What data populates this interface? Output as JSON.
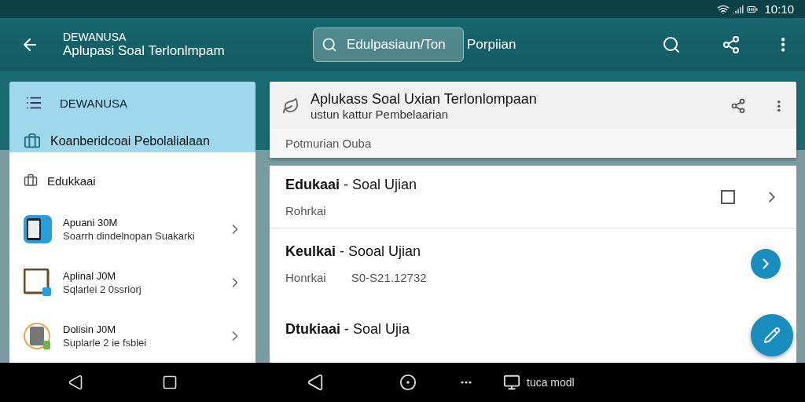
{
  "status_bar": {
    "time": "10:10"
  },
  "app_bar": {
    "subtitle": "DEWANUSA",
    "title": "Aplupasi Soal Terlonlmpam",
    "search": {
      "value": "Edulpasiaun/Ton"
    },
    "search_suffix": "Porpiian"
  },
  "drawer": {
    "header": "DEWANUSA",
    "sections": [
      {
        "label": "Koanberidcoai Pebolalialaan",
        "kind": "category"
      },
      {
        "label": "Edukkaai",
        "kind": "section"
      }
    ],
    "apps": [
      {
        "title": "Apuani 30M",
        "subtitle": "Soarrh dindelnopan Suakarki",
        "kind": "tablet"
      },
      {
        "title": "Aplinal J0M",
        "subtitle": "Sqlarlei 2 0ssriorj",
        "kind": "board"
      },
      {
        "title": "Dolisin J0M",
        "subtitle": "Suplarle 2 ie fsblei",
        "kind": "device"
      }
    ]
  },
  "header_card": {
    "title": "Aplukass Soal Uxian Terlonlompaan",
    "subtitle": "ustun kattur Pembelaarian",
    "note": "Potmurian Ouba"
  },
  "rows": [
    {
      "bold": "Edukaai",
      "rest": " - Soal Ujian",
      "meta": "Rohrkai",
      "kind": "checkbox",
      "checked": false
    },
    {
      "bold": "Keulkai",
      "rest": " - Sooal Ujian",
      "meta": "Honrkai",
      "code": "S0-S21.12732",
      "kind": "button"
    },
    {
      "bold": "Dtukiaai",
      "rest": " - Soal Ujia",
      "kind": "plain"
    }
  ],
  "nav_bar": {
    "label": "tuca modl"
  }
}
